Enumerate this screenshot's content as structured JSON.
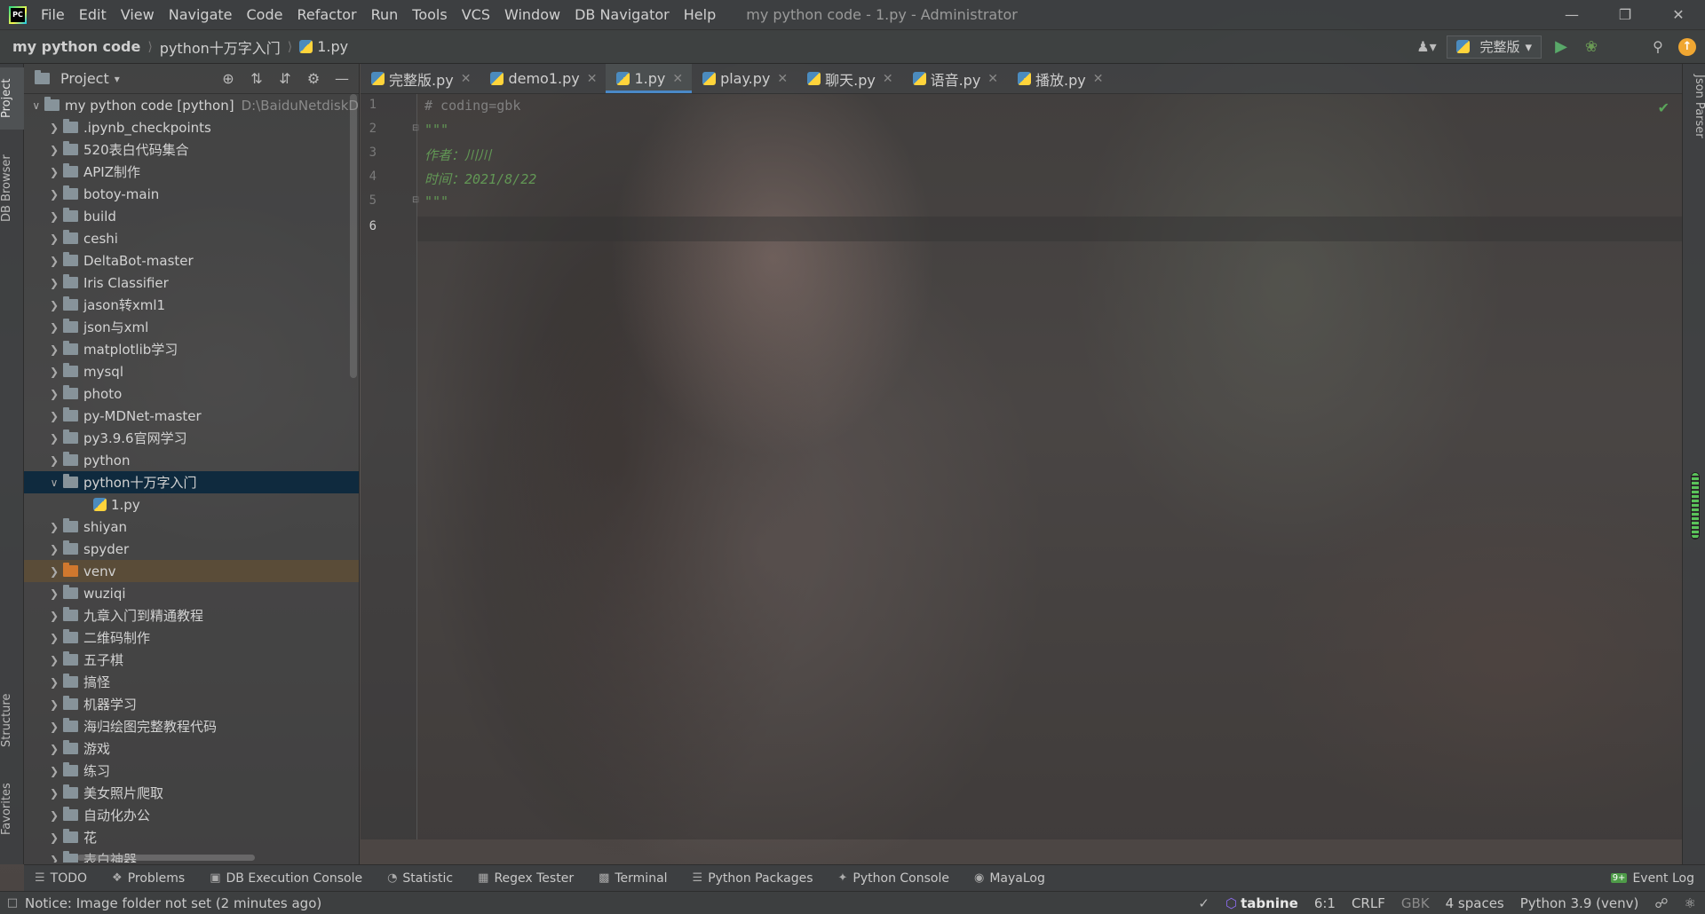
{
  "menubar": {
    "items": [
      "File",
      "Edit",
      "View",
      "Navigate",
      "Code",
      "Refactor",
      "Run",
      "Tools",
      "VCS",
      "Window",
      "DB Navigator",
      "Help"
    ],
    "window_title": "my python code - 1.py - Administrator"
  },
  "breadcrumb": {
    "project": "my python code",
    "folder": "python十万字入门",
    "file": "1.py"
  },
  "run_config": {
    "label": "完整版"
  },
  "left_strip": {
    "project": "Project",
    "db_browser": "DB Browser",
    "structure": "Structure",
    "favorites": "Favorites"
  },
  "project_panel": {
    "title": "Project",
    "root": {
      "name": "my python code [python]",
      "path": "D:\\BaiduNetdiskD"
    },
    "items": [
      ".ipynb_checkpoints",
      "520表白代码集合",
      "APIZ制作",
      "botoy-main",
      "build",
      "ceshi",
      "DeltaBot-master",
      "Iris Classifier",
      "jason转xml1",
      "json与xml",
      "matplotlib学习",
      "mysql",
      "photo",
      "py-MDNet-master",
      "py3.9.6官网学习",
      "python"
    ],
    "selected_folder": "python十万字入门",
    "selected_file": "1.py",
    "items_after": [
      "shiyan",
      "spyder",
      "venv",
      "wuziqi",
      "九章入门到精通教程",
      "二维码制作",
      "五子棋",
      "搞怪",
      "机器学习",
      "海归绘图完整教程代码",
      "游戏",
      "练习",
      "美女照片爬取",
      "自动化办公",
      "花",
      "表白神器"
    ]
  },
  "editor_tabs": [
    {
      "label": "完整版.py",
      "active": false
    },
    {
      "label": "demo1.py",
      "active": false
    },
    {
      "label": "1.py",
      "active": true
    },
    {
      "label": "play.py",
      "active": false
    },
    {
      "label": "聊天.py",
      "active": false
    },
    {
      "label": "语音.py",
      "active": false
    },
    {
      "label": "播放.py",
      "active": false
    }
  ],
  "code": {
    "line_numbers": [
      "1",
      "2",
      "3",
      "4",
      "5",
      "6"
    ],
    "line1": "# coding=gbk",
    "line2": "\"\"\"",
    "line3": "作者：川川",
    "line4": "时间：2021/8/22",
    "line5": "\"\"\""
  },
  "right_strip": {
    "json_parser": "Json Parser"
  },
  "bottom_tools": [
    "TODO",
    "Problems",
    "DB Execution Console",
    "Statistic",
    "Regex Tester",
    "Terminal",
    "Python Packages",
    "Python Console",
    "MayaLog"
  ],
  "event_log": {
    "badge": "9+",
    "label": "Event Log"
  },
  "status": {
    "notice": "Notice: Image folder not set (2 minutes ago)",
    "tabnine": "tabnine",
    "position": "6:1",
    "line_sep": "CRLF",
    "encoding": "GBK",
    "indent": "4 spaces",
    "interpreter": "Python 3.9 (venv)"
  },
  "colors": {
    "accent": "#4a88c7",
    "selection": "#0d293e",
    "comment": "#808080",
    "docstring": "#629755"
  }
}
